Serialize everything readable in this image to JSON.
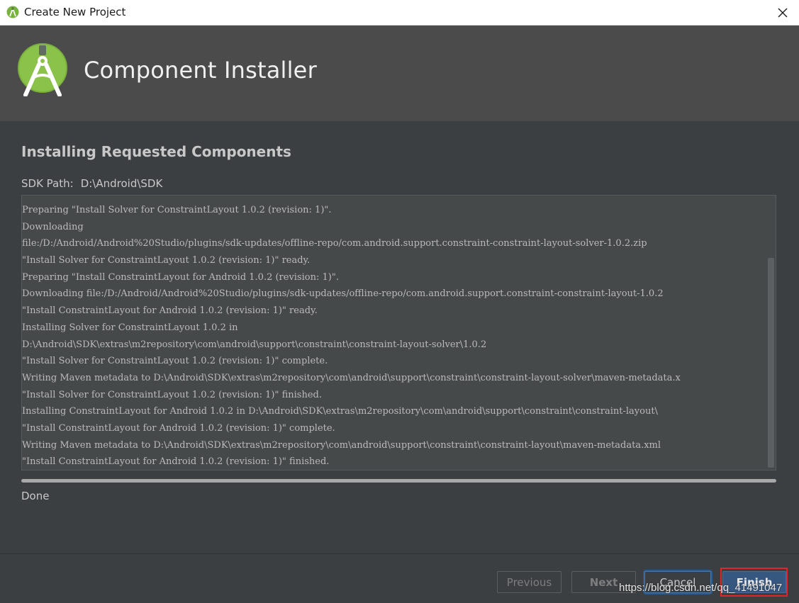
{
  "window": {
    "title": "Create New Project",
    "close_icon": "close-icon"
  },
  "header": {
    "logo_icon": "android-studio-logo",
    "title": "Component Installer"
  },
  "main": {
    "section_title": "Installing Requested Components",
    "sdk_path_label": "SDK Path:",
    "sdk_path_value": "D:\\Android\\SDK",
    "log_lines": [
      "Preparing \"Install Solver for ConstraintLayout 1.0.2 (revision: 1)\".",
      "Downloading",
      "file:/D:/Android/Android%20Studio/plugins/sdk-updates/offline-repo/com.android.support.constraint-constraint-layout-solver-1.0.2.zip",
      "\"Install Solver for ConstraintLayout 1.0.2 (revision: 1)\" ready.",
      "Preparing \"Install ConstraintLayout for Android 1.0.2 (revision: 1)\".",
      "Downloading file:/D:/Android/Android%20Studio/plugins/sdk-updates/offline-repo/com.android.support.constraint-constraint-layout-1.0.2",
      "\"Install ConstraintLayout for Android 1.0.2 (revision: 1)\" ready.",
      "Installing Solver for ConstraintLayout 1.0.2 in",
      "D:\\Android\\SDK\\extras\\m2repository\\com\\android\\support\\constraint\\constraint-layout-solver\\1.0.2",
      "\"Install Solver for ConstraintLayout 1.0.2 (revision: 1)\" complete.",
      "Writing Maven metadata to D:\\Android\\SDK\\extras\\m2repository\\com\\android\\support\\constraint\\constraint-layout-solver\\maven-metadata.x",
      "\"Install Solver for ConstraintLayout 1.0.2 (revision: 1)\" finished.",
      "Installing ConstraintLayout for Android 1.0.2 in D:\\Android\\SDK\\extras\\m2repository\\com\\android\\support\\constraint\\constraint-layout\\",
      "\"Install ConstraintLayout for Android 1.0.2 (revision: 1)\" complete.",
      "Writing Maven metadata to D:\\Android\\SDK\\extras\\m2repository\\com\\android\\support\\constraint\\constraint-layout\\maven-metadata.xml",
      "\"Install ConstraintLayout for Android 1.0.2 (revision: 1)\" finished."
    ],
    "progress": 1.0,
    "status": "Done"
  },
  "footer": {
    "previous_label": "Previous",
    "next_label": "Next",
    "cancel_label": "Cancel",
    "finish_label": "Finish"
  },
  "watermark": "https://blog.csdn.net/qq_41491047",
  "colors": {
    "background": "#3c3f41",
    "header": "#4b4b4b",
    "accent": "#365880",
    "highlight": "#e0262b",
    "android_green": "#8bc34a"
  }
}
